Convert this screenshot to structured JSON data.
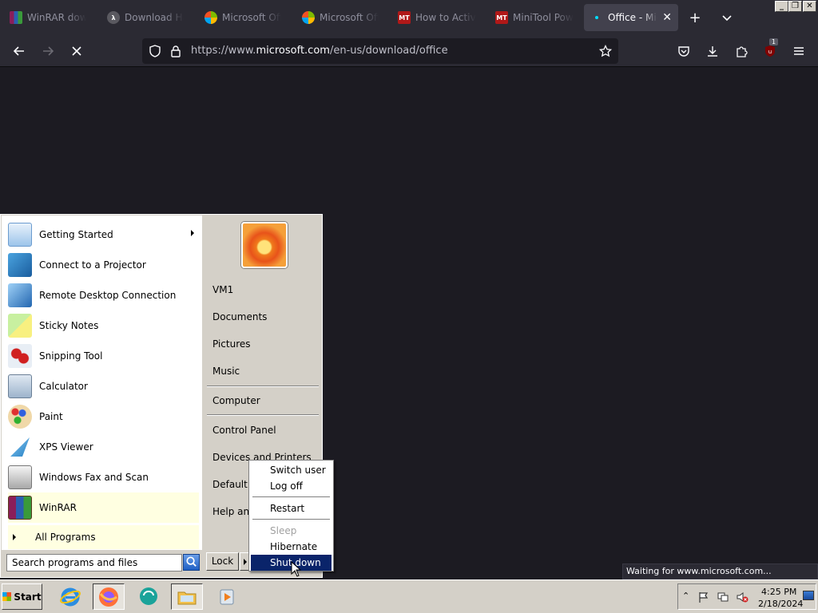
{
  "browser": {
    "tabs": [
      {
        "title": "WinRAR downlo",
        "favicon": "winrar-icon",
        "active": false
      },
      {
        "title": "Download Half-",
        "favicon": "halflife-icon",
        "active": false
      },
      {
        "title": "Microsoft Office",
        "favicon": "office-icon",
        "active": false
      },
      {
        "title": "Microsoft Office",
        "favicon": "office-icon",
        "active": false
      },
      {
        "title": "How to Activat",
        "favicon": "minitool-icon",
        "active": false
      },
      {
        "title": "MiniTool Power",
        "favicon": "minitool-icon",
        "active": false
      },
      {
        "title": "Office - Micro",
        "favicon": "loading-dot",
        "active": true
      }
    ],
    "url": {
      "prefix": "https://www.",
      "host": "microsoft.com",
      "path": "/en-us/download/office"
    },
    "extension_badge": "1",
    "status_text": "Waiting for www.microsoft.com..."
  },
  "start_menu": {
    "programs": [
      {
        "label": "Getting Started",
        "icon": "getting-started-icon",
        "has_submenu": true
      },
      {
        "label": "Connect to a Projector",
        "icon": "projector-icon"
      },
      {
        "label": "Remote Desktop Connection",
        "icon": "remote-desktop-icon"
      },
      {
        "label": "Sticky Notes",
        "icon": "sticky-notes-icon"
      },
      {
        "label": "Snipping Tool",
        "icon": "snipping-tool-icon"
      },
      {
        "label": "Calculator",
        "icon": "calculator-icon"
      },
      {
        "label": "Paint",
        "icon": "paint-icon"
      },
      {
        "label": "XPS Viewer",
        "icon": "xps-viewer-icon"
      },
      {
        "label": "Windows Fax and Scan",
        "icon": "fax-scan-icon"
      },
      {
        "label": "WinRAR",
        "icon": "winrar-icon",
        "highlighted": true
      }
    ],
    "all_programs": "All Programs",
    "places": {
      "user": "VM1",
      "documents": "Documents",
      "pictures": "Pictures",
      "music": "Music",
      "computer": "Computer",
      "control_panel": "Control Panel",
      "devices": "Devices and Printers",
      "default_programs": "Default P",
      "help": "Help and"
    },
    "search_placeholder": "Search programs and files",
    "lock_label": "Lock",
    "power_menu": {
      "switch_user": "Switch user",
      "log_off": "Log off",
      "restart": "Restart",
      "sleep": "Sleep",
      "hibernate": "Hibernate",
      "shut_down": "Shut down"
    }
  },
  "taskbar": {
    "start_label": "Start",
    "clock_time": "4:25 PM",
    "clock_date": "2/18/2024"
  }
}
